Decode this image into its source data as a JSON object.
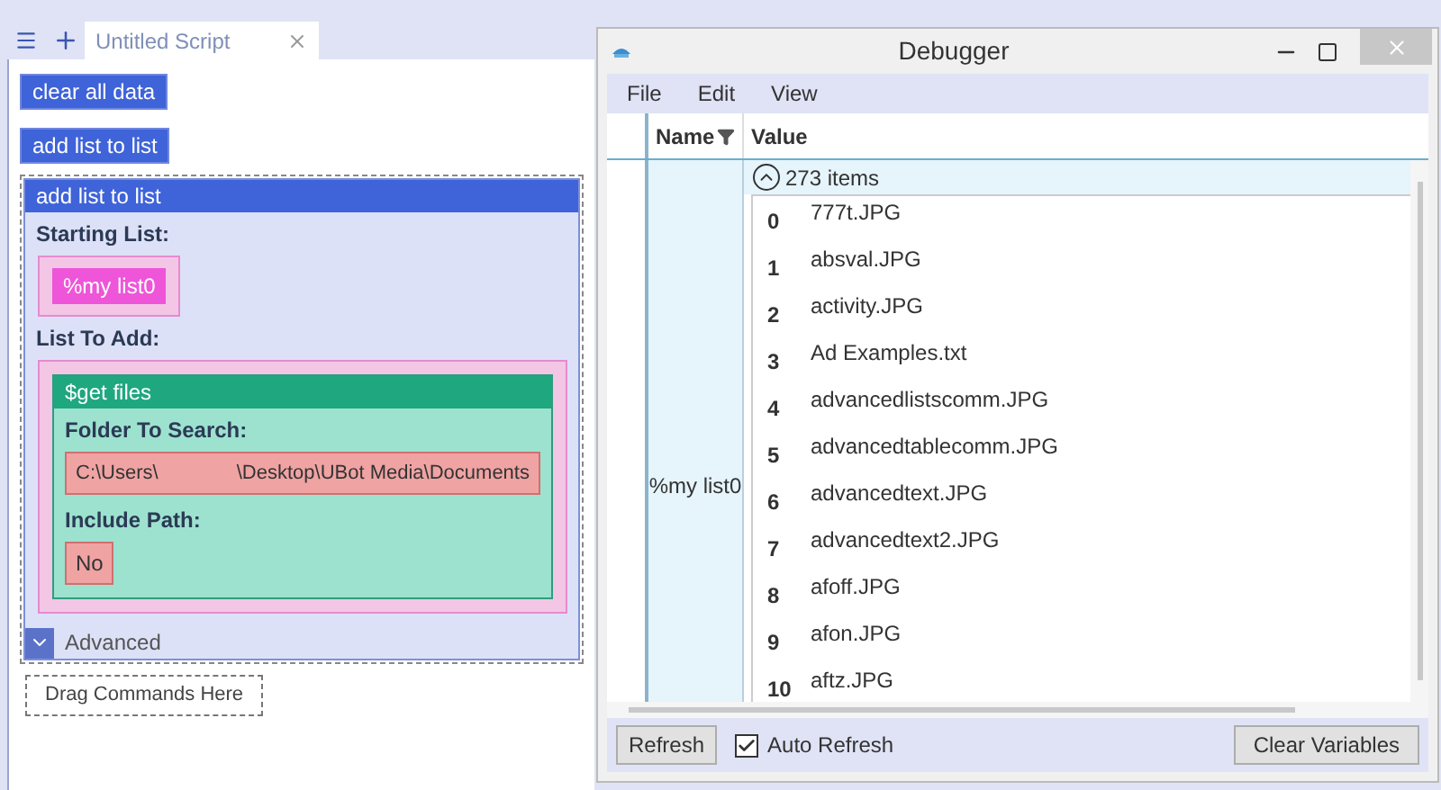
{
  "editor": {
    "tab": {
      "label": "Untitled Script",
      "selected": true
    },
    "commands": [
      {
        "label": "clear all data"
      },
      {
        "label": "add list to list"
      }
    ],
    "block": {
      "title": "add list to list",
      "params": [
        {
          "label": "Starting List:",
          "kind": "variable",
          "value": "%my list0"
        },
        {
          "label": "List To Add:",
          "kind": "block",
          "block": {
            "title": "$get files",
            "params": [
              {
                "label": "Folder To Search:",
                "kind": "path",
                "parts": [
                  "C:\\Users\\",
                  "\\Desktop\\UBot Media\\Documents"
                ]
              },
              {
                "label": "Include Path:",
                "kind": "text",
                "value": "No"
              }
            ]
          }
        }
      ],
      "advanced": {
        "label": "Advanced",
        "expanded": false
      }
    },
    "drop_hint": "Drag Commands Here"
  },
  "debugger": {
    "title": "Debugger",
    "menu": [
      "File",
      "Edit",
      "View"
    ],
    "columns": [
      "Name",
      "Value"
    ],
    "variable": {
      "name": "%my list0",
      "expanded": true,
      "count": "273 items",
      "items": [
        {
          "index": "0",
          "value": "777t.JPG"
        },
        {
          "index": "1",
          "value": "absval.JPG"
        },
        {
          "index": "2",
          "value": "activity.JPG"
        },
        {
          "index": "3",
          "value": "Ad Examples.txt"
        },
        {
          "index": "4",
          "value": "advancedlistscomm.JPG"
        },
        {
          "index": "5",
          "value": "advancedtablecomm.JPG"
        },
        {
          "index": "6",
          "value": "advancedtext.JPG"
        },
        {
          "index": "7",
          "value": "advancedtext2.JPG"
        },
        {
          "index": "8",
          "value": "afoff.JPG"
        },
        {
          "index": "9",
          "value": "afon.JPG"
        },
        {
          "index": "10",
          "value": "aftz.JPG"
        }
      ]
    },
    "refresh": "Refresh",
    "auto_refresh": {
      "label": "Auto Refresh",
      "checked": true
    },
    "clear": "Clear Variables"
  }
}
